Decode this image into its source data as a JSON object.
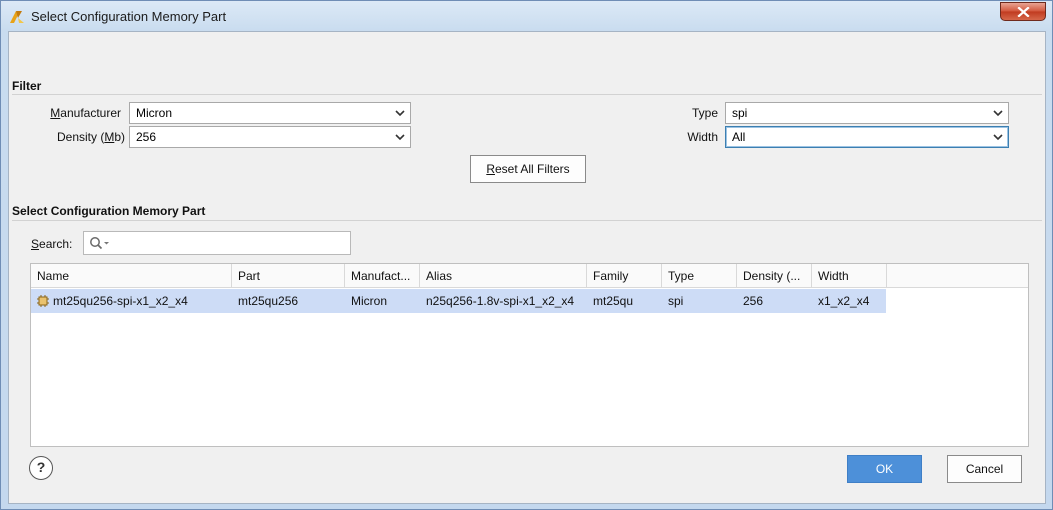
{
  "window": {
    "title": "Select Configuration Memory Part"
  },
  "filter": {
    "section_title": "Filter",
    "manufacturer": {
      "label": "Manufacturer",
      "value": "Micron"
    },
    "density": {
      "label": "Density (Mb)",
      "value": "256"
    },
    "type": {
      "label": "Type",
      "value": "spi"
    },
    "width": {
      "label": "Width",
      "value": "All"
    },
    "reset_label": "Reset All Filters"
  },
  "parts": {
    "section_title": "Select Configuration Memory Part",
    "search_label": "Search:",
    "columns": [
      "Name",
      "Part",
      "Manufact...",
      "Alias",
      "Family",
      "Type",
      "Density (...",
      "Width"
    ],
    "rows": [
      [
        "mt25qu256-spi-x1_x2_x4",
        "mt25qu256",
        "Micron",
        "n25q256-1.8v-spi-x1_x2_x4",
        "mt25qu",
        "spi",
        "256",
        "x1_x2_x4"
      ]
    ]
  },
  "footer": {
    "help_label": "?",
    "ok_label": "OK",
    "cancel_label": "Cancel"
  },
  "icons": [
    "app-icon",
    "close-icon",
    "chevron-down-icon",
    "search-icon",
    "memory-chip-icon",
    "help-icon"
  ]
}
